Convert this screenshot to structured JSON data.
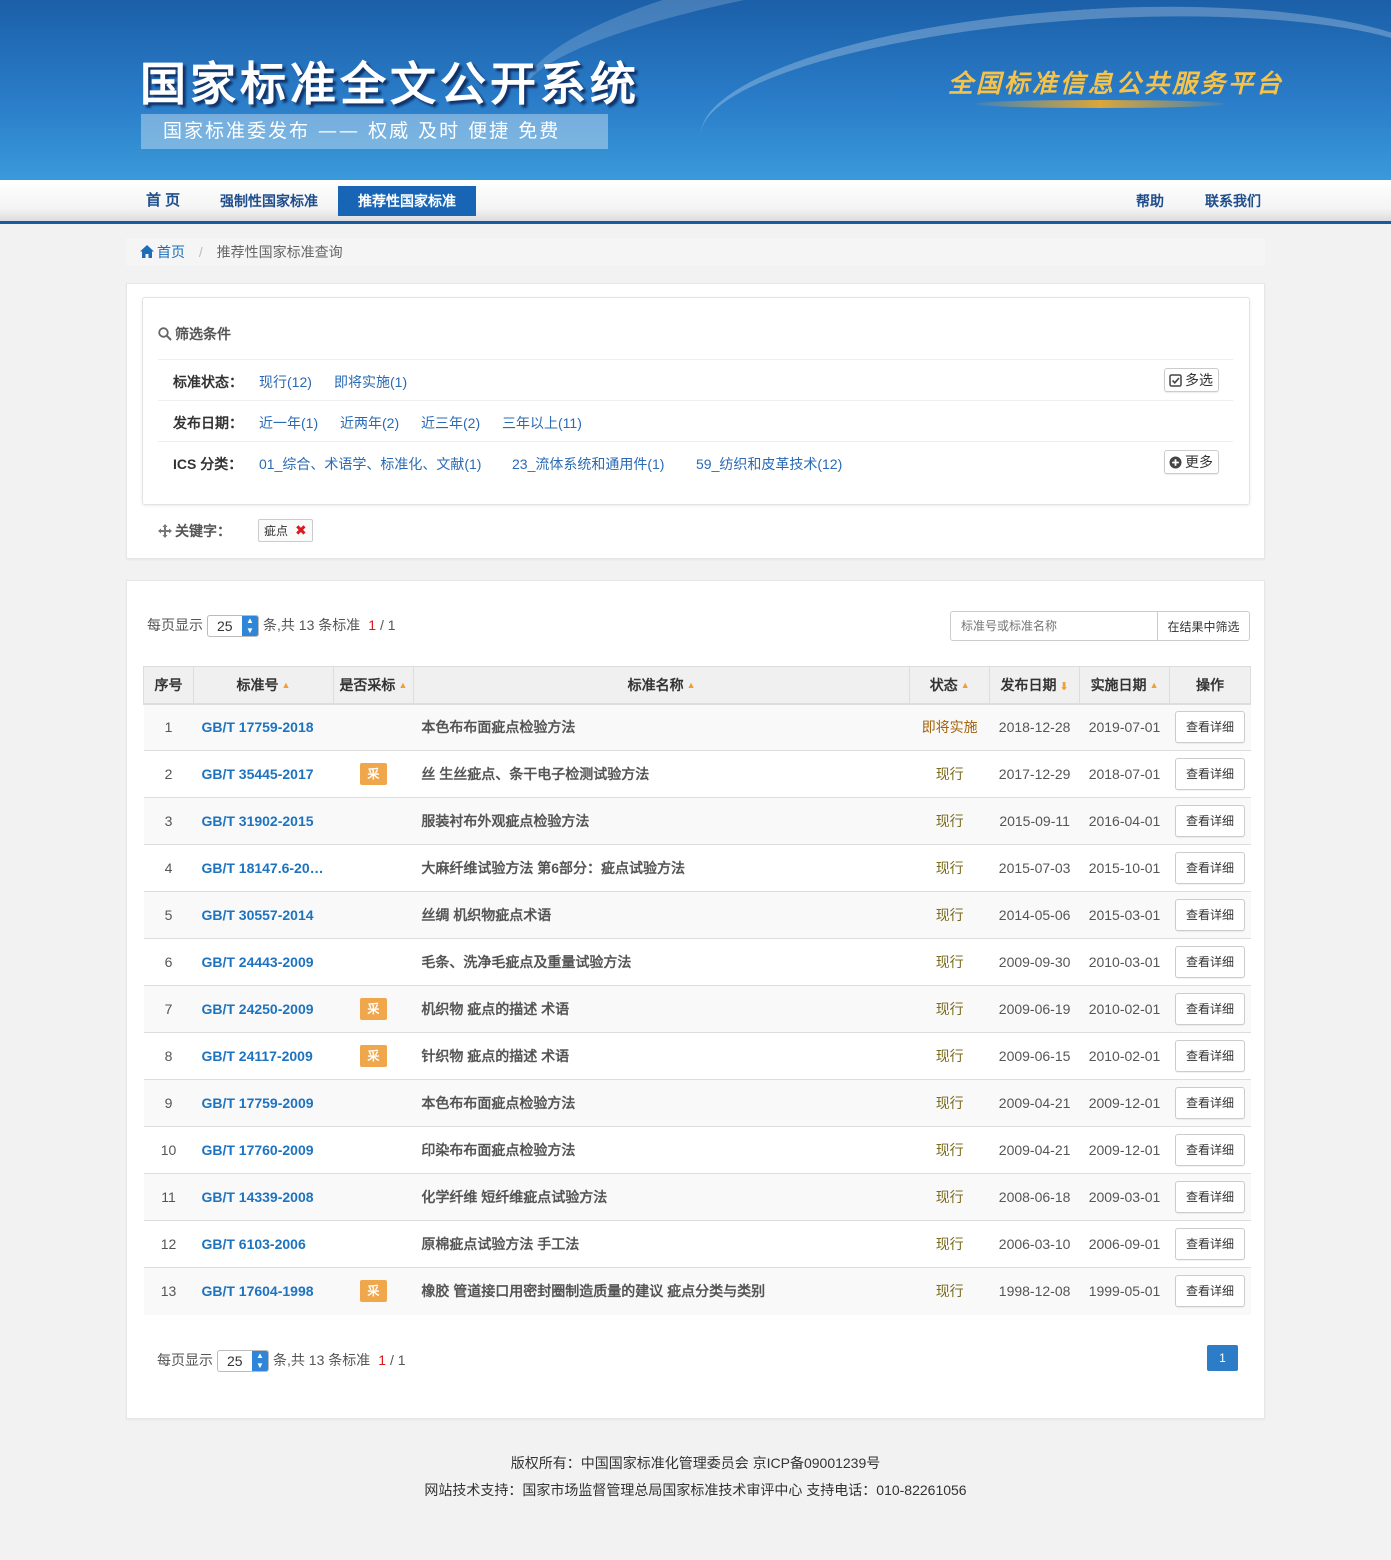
{
  "banner": {
    "title": "国家标准全文公开系统",
    "subtitle": "国家标准委发布 —— 权威 及时 便捷 免费",
    "slogan": "全国标准信息公共服务平台"
  },
  "nav": {
    "home": "首 页",
    "mandatory": "强制性国家标准",
    "recommended": "推荐性国家标准",
    "help": "帮助",
    "contact": "联系我们"
  },
  "breadcrumb": {
    "home": "首页",
    "current": "推荐性国家标准查询"
  },
  "filter": {
    "heading": "筛选条件",
    "status": {
      "label": "标准状态：",
      "options": [
        "现行(12)",
        "即将实施(1)"
      ],
      "button": "多选"
    },
    "date": {
      "label": "发布日期：",
      "options": [
        "近一年(1)",
        "近两年(2)",
        "近三年(2)",
        "三年以上(11)"
      ]
    },
    "ics": {
      "label": "ICS 分类：",
      "options": [
        "01_综合、术语学、标准化、文献(1)",
        "23_流体系统和通用件(1)",
        "59_纺织和皮革技术(12)"
      ],
      "button": "更多"
    },
    "keyword_label": "关键字：",
    "keyword": "疵点"
  },
  "pager": {
    "prefix": "每页显示",
    "page_size": "25",
    "suffix": "条,共 13 条标准",
    "current": "1",
    "total": "/ 1"
  },
  "search": {
    "placeholder": "标准号或标准名称",
    "button": "在结果中筛选"
  },
  "table": {
    "headers": {
      "index": "序号",
      "code": "标准号",
      "adopted": "是否采标",
      "name": "标准名称",
      "status": "状态",
      "pub": "发布日期",
      "impl": "实施日期",
      "op": "操作"
    },
    "rows": [
      {
        "index": "1",
        "code": "GB/T 17759-2018",
        "adopted": "",
        "name": "本色布布面疵点检验方法",
        "status": "即将实施",
        "pub": "2018-12-28",
        "impl": "2019-07-01",
        "op": "查看详细"
      },
      {
        "index": "2",
        "code": "GB/T 35445-2017",
        "adopted": "采",
        "name": "丝 生丝疵点、条干电子检测试验方法",
        "status": "现行",
        "pub": "2017-12-29",
        "impl": "2018-07-01",
        "op": "查看详细"
      },
      {
        "index": "3",
        "code": "GB/T 31902-2015",
        "adopted": "",
        "name": "服装衬布外观疵点检验方法",
        "status": "现行",
        "pub": "2015-09-11",
        "impl": "2016-04-01",
        "op": "查看详细"
      },
      {
        "index": "4",
        "code": "GB/T 18147.6-20…",
        "adopted": "",
        "name": "大麻纤维试验方法 第6部分：疵点试验方法",
        "status": "现行",
        "pub": "2015-07-03",
        "impl": "2015-10-01",
        "op": "查看详细"
      },
      {
        "index": "5",
        "code": "GB/T 30557-2014",
        "adopted": "",
        "name": "丝绸 机织物疵点术语",
        "status": "现行",
        "pub": "2014-05-06",
        "impl": "2015-03-01",
        "op": "查看详细"
      },
      {
        "index": "6",
        "code": "GB/T 24443-2009",
        "adopted": "",
        "name": "毛条、洗净毛疵点及重量试验方法",
        "status": "现行",
        "pub": "2009-09-30",
        "impl": "2010-03-01",
        "op": "查看详细"
      },
      {
        "index": "7",
        "code": "GB/T 24250-2009",
        "adopted": "采",
        "name": "机织物 疵点的描述 术语",
        "status": "现行",
        "pub": "2009-06-19",
        "impl": "2010-02-01",
        "op": "查看详细"
      },
      {
        "index": "8",
        "code": "GB/T 24117-2009",
        "adopted": "采",
        "name": "针织物 疵点的描述 术语",
        "status": "现行",
        "pub": "2009-06-15",
        "impl": "2010-02-01",
        "op": "查看详细"
      },
      {
        "index": "9",
        "code": "GB/T 17759-2009",
        "adopted": "",
        "name": "本色布布面疵点检验方法",
        "status": "现行",
        "pub": "2009-04-21",
        "impl": "2009-12-01",
        "op": "查看详细"
      },
      {
        "index": "10",
        "code": "GB/T 17760-2009",
        "adopted": "",
        "name": "印染布布面疵点检验方法",
        "status": "现行",
        "pub": "2009-04-21",
        "impl": "2009-12-01",
        "op": "查看详细"
      },
      {
        "index": "11",
        "code": "GB/T 14339-2008",
        "adopted": "",
        "name": "化学纤维 短纤维疵点试验方法",
        "status": "现行",
        "pub": "2008-06-18",
        "impl": "2009-03-01",
        "op": "查看详细"
      },
      {
        "index": "12",
        "code": "GB/T 6103-2006",
        "adopted": "",
        "name": "原棉疵点试验方法 手工法",
        "status": "现行",
        "pub": "2006-03-10",
        "impl": "2006-09-01",
        "op": "查看详细"
      },
      {
        "index": "13",
        "code": "GB/T 17604-1998",
        "adopted": "采",
        "name": "橡胶 管道接口用密封圈制造质量的建议 疵点分类与类别",
        "status": "现行",
        "pub": "1998-12-08",
        "impl": "1999-05-01",
        "op": "查看详细"
      }
    ]
  },
  "pagination": {
    "page": "1"
  },
  "footer": {
    "line1": "版权所有：中国国家标准化管理委员会 京ICP备09001239号",
    "line2": "网站技术支持：国家市场监督管理总局国家标准技术审评中心 支持电话：010-82261056"
  },
  "colors": {
    "primary": "#1865b5",
    "link": "#1d73c0",
    "adopted": "#f0a64a",
    "danger": "#d9191e"
  }
}
